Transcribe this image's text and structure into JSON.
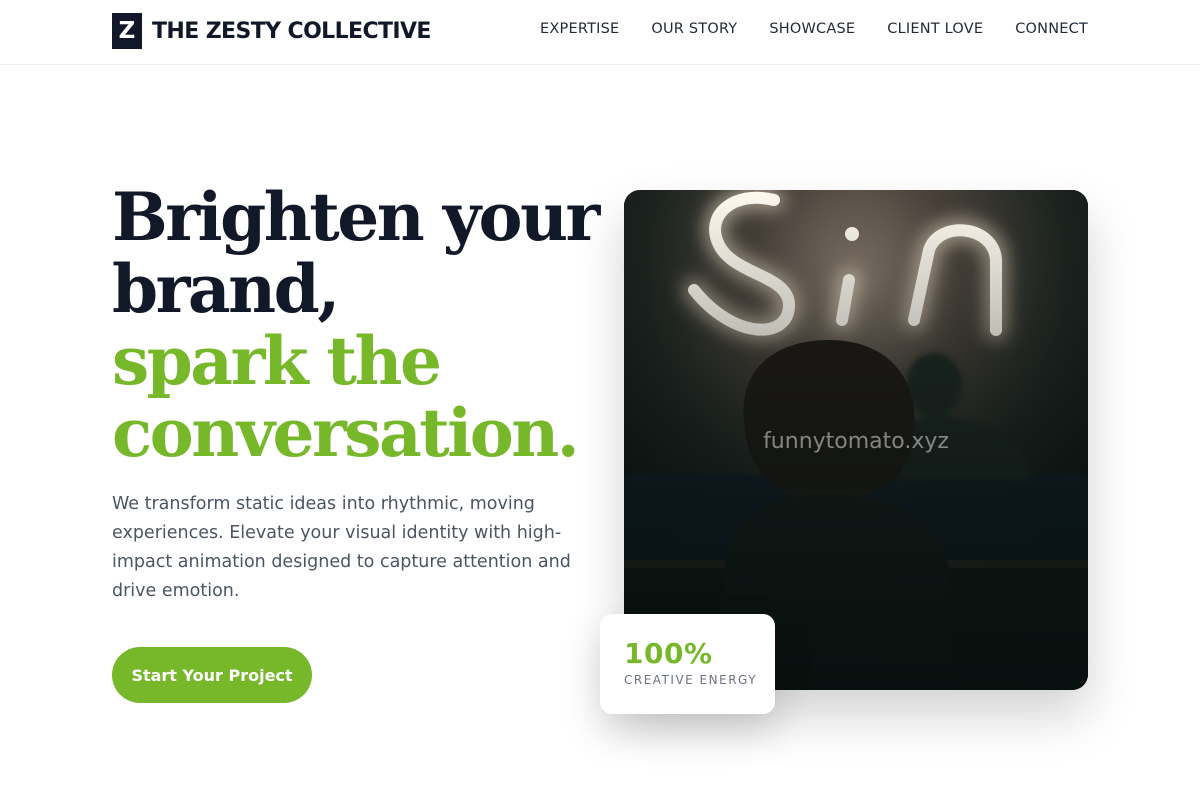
{
  "brand": {
    "mark": "Z",
    "name": "THE ZESTY COLLECTIVE"
  },
  "nav": {
    "items": [
      {
        "label": "EXPERTISE"
      },
      {
        "label": "OUR STORY"
      },
      {
        "label": "SHOWCASE"
      },
      {
        "label": "CLIENT LOVE"
      },
      {
        "label": "CONNECT"
      }
    ]
  },
  "hero": {
    "heading_lines": [
      {
        "text": "Brighten your",
        "color": "#111827"
      },
      {
        "text": "brand,",
        "color": "#111827"
      },
      {
        "text": "spark the",
        "color": "#76b82a"
      },
      {
        "text": "conversation.",
        "color": "#76b82a"
      }
    ],
    "description": "We transform static ideas into rhythmic, moving experiences. Elevate your visual identity with high-impact animation designed to capture attention and drive emotion.",
    "cta_label": "Start Your Project"
  },
  "image": {
    "neon_text": "Sin",
    "watermark": "funnytomato.xyz"
  },
  "stat": {
    "value": "100%",
    "label": "CREATIVE ENERGY"
  },
  "colors": {
    "accent": "#76b82a",
    "dark": "#111827",
    "body_text": "#4b5563"
  }
}
